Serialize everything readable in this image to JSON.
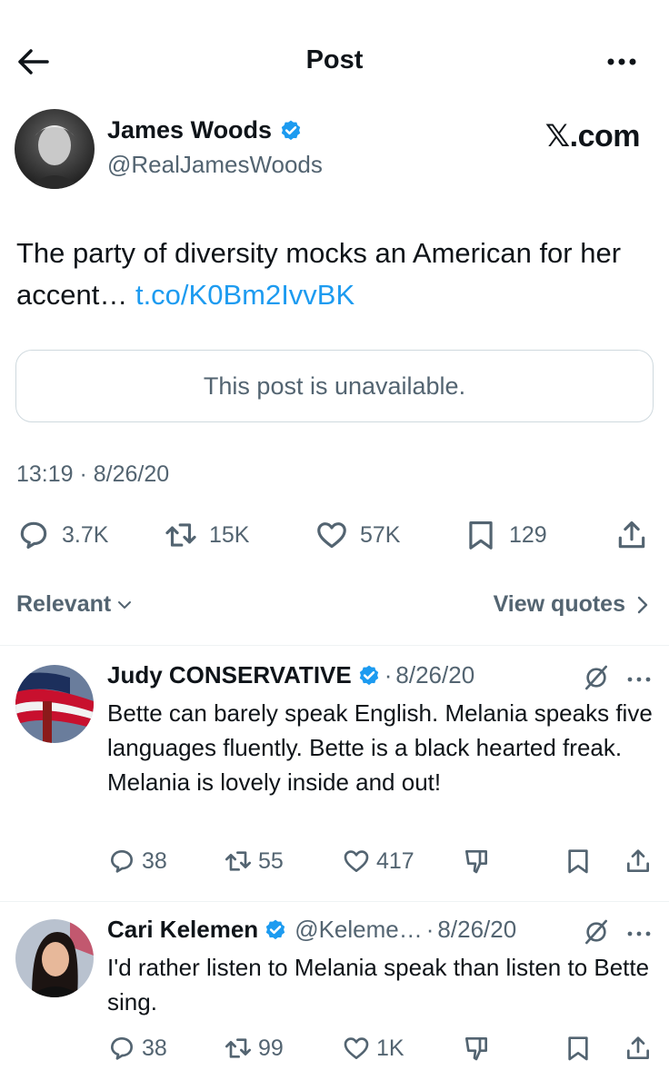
{
  "header": {
    "title": "Post"
  },
  "post": {
    "author_name": "James Woods",
    "author_handle": "@RealJamesWoods",
    "watermark": "𝕏.com",
    "text": "The party of diversity mocks an American for her accent… ",
    "link": "t.co/K0Bm2IvvBK",
    "unavailable_notice": "This post is unavailable.",
    "timestamp": "13:19 · 8/26/20",
    "stats": {
      "replies": "3.7K",
      "reposts": "15K",
      "likes": "57K",
      "bookmarks": "129"
    }
  },
  "sort": {
    "relevant_label": "Relevant",
    "view_quotes_label": "View quotes"
  },
  "replies": [
    {
      "name": "Judy CONSERVATIVE",
      "handle": "",
      "date": "8/26/20",
      "text": "Bette can barely speak English.  Melania speaks five languages fluently.   Bette is a black hearted freak.  Melania is lovely inside and out!",
      "replies": "38",
      "reposts": "55",
      "likes": "417"
    },
    {
      "name": "Cari Kelemen",
      "handle": "@Keleme…",
      "date": "8/26/20",
      "text": "I'd rather listen to Melania speak than listen to Bette sing.",
      "replies": "38",
      "reposts": "99",
      "likes": "1K"
    }
  ],
  "colors": {
    "accent": "#1d9bf0",
    "muted": "#536471",
    "text": "#0f1419",
    "border": "#cfd9de"
  },
  "icons": [
    "back-arrow-icon",
    "more-icon",
    "verified-badge-icon",
    "reply-icon",
    "repost-icon",
    "like-icon",
    "bookmark-icon",
    "share-icon",
    "chevron-down-icon",
    "chevron-right-icon",
    "mute-icon",
    "downvote-icon"
  ]
}
